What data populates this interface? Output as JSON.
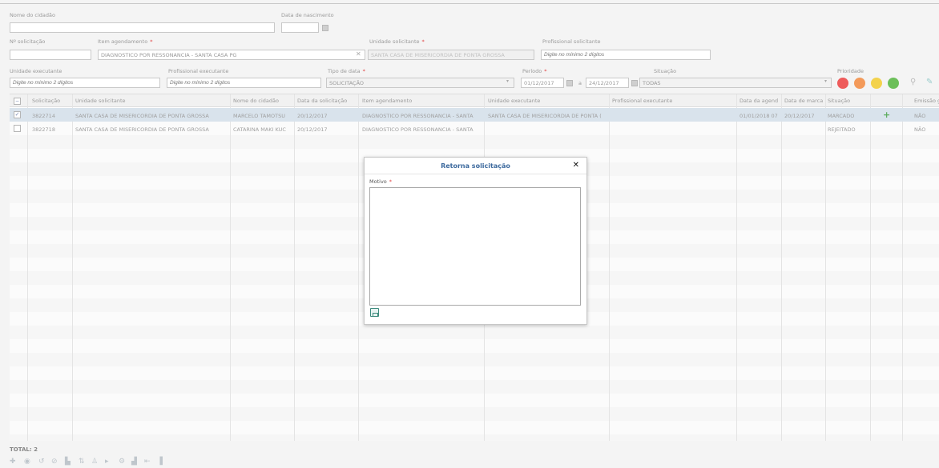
{
  "filters": {
    "nome_cidadao": {
      "label": "Nome do cidadão",
      "value": ""
    },
    "data_nascimento": {
      "label": "Data de nascimento",
      "value": ""
    },
    "num_solicitacao": {
      "label": "Nº solicitação",
      "value": ""
    },
    "item_agendamento": {
      "label": "Item agendamento",
      "value": "DIAGNOSTICO POR RESSONANCIA - SANTA CASA PG"
    },
    "unidade_solicitante": {
      "label": "Unidade solicitante",
      "value": "SANTA CASA DE MISERICORDIA DE PONTA GROSSA"
    },
    "profissional_solicitante": {
      "label": "Profissional solicitante",
      "placeholder": "Digite no mínimo 2 dígitos"
    },
    "unidade_executante": {
      "label": "Unidade executante",
      "placeholder": "Digite no mínimo 2 dígitos"
    },
    "profissional_executante": {
      "label": "Profissional executante",
      "placeholder": "Digite no mínimo 2 dígitos"
    },
    "tipo_data": {
      "label": "Tipo de data",
      "value": "SOLICITAÇÃO"
    },
    "periodo": {
      "label": "Período",
      "from": "01/12/2017",
      "sep": "a",
      "to": "24/12/2017"
    },
    "situacao": {
      "label": "Situação",
      "value": "TODAS"
    },
    "prioridade": {
      "label": "Prioridade"
    },
    "required_mark": "*"
  },
  "priority_colors": [
    "#ee5b5b",
    "#f39a5a",
    "#f3d24c",
    "#6cbf5a"
  ],
  "grid": {
    "columns": [
      "Solicitação",
      "Unidade solicitante",
      "Nome do cidadão",
      "Data da solicitação",
      "Item agendamento",
      "Unidade executante",
      "Profissional executante",
      "Data da agend",
      "Data de marca",
      "Situação",
      "",
      "Emissão guia"
    ],
    "rows": [
      {
        "checked": "✓",
        "solicitacao": "3822714",
        "unidade_solicitante": "SANTA CASA DE MISERICORDIA DE PONTA GROSSA",
        "nome": "MARCELO TAMOTSU",
        "data_solicitacao": "20/12/2017",
        "item": "DIAGNOSTICO POR RESSONANCIA - SANTA",
        "unidade_executante": "SANTA CASA DE MISERICORDIA DE PONTA (",
        "profissional": "",
        "data_agend": "01/01/2018 07",
        "data_marca": "20/12/2017",
        "situacao": "MARCADO",
        "emissao": "NÃO"
      },
      {
        "checked": "",
        "solicitacao": "3822718",
        "unidade_solicitante": "SANTA CASA DE MISERICORDIA DE PONTA GROSSA",
        "nome": "CATARINA MAKI KUC",
        "data_solicitacao": "20/12/2017",
        "item": "DIAGNOSTICO POR RESSONANCIA - SANTA",
        "unidade_executante": "",
        "profissional": "",
        "data_agend": "",
        "data_marca": "",
        "situacao": "REJEITADO",
        "emissao": "NÃO"
      }
    ]
  },
  "footer": {
    "total_label": "TOTAL: 2"
  },
  "modal": {
    "title": "Retorna solicitação",
    "close": "✕",
    "motivo_label": "Motivo",
    "motivo_value": ""
  },
  "icons": {
    "search": "search-icon",
    "close": "close-icon",
    "save": "save-icon",
    "add": "plus-icon",
    "calendar": "calendar-icon"
  }
}
